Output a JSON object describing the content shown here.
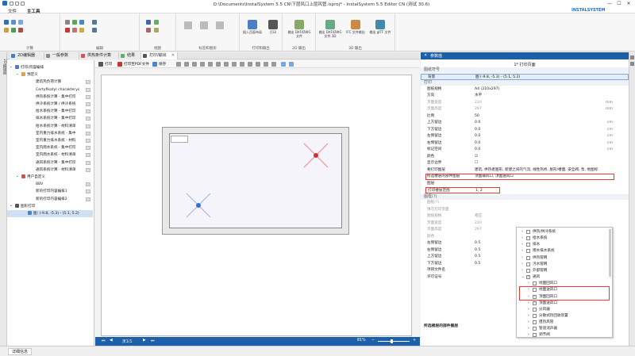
{
  "window": {
    "title": "D:\\Documents\\InstalSystem 5.5 CN\\下层风口上层风管.isproj* - InstalSystem 5.5 Editor CN (测试 30.6)",
    "controls": [
      "—",
      "☐",
      "✕"
    ]
  },
  "menu": {
    "items": [
      "文件",
      "主工具"
    ],
    "brand": "INSTALSYSTEM",
    "search": "更改屏幕的窗口布置"
  },
  "ribbon": {
    "groups": [
      "计算",
      "编辑",
      "视图",
      "标签和图形",
      "打印和输出",
      "2D 输出",
      "3D 输出"
    ],
    "buttons": [
      "插入页面布局",
      "打印",
      "输出 DXF/DWG 文件",
      "输出 DXF/DWG 文件 3D",
      "IFC 文件输出",
      "输出 gITF 文件"
    ]
  },
  "left_rail": "2D编辑器",
  "tabs": [
    "2D编辑器",
    "一般参数",
    "供热条件计算",
    "结果",
    "打印/输出"
  ],
  "tree": {
    "root": "打印/内容编排",
    "predefined": "预定义",
    "items": [
      "建筑热负荷计算",
      "CertyfikatyI charakterys",
      "供热系统计算 - 集中打印",
      "供冷系统计算 / 供冷系统",
      "给水系统计算 - 集中打印",
      "排水系统计算 - 集中打印",
      "给水系统计算 - 材料清单",
      "室内重力排水系统 - 集中",
      "室内重力排水系统 - 材料",
      "室内雨水系统 - 集中打印",
      "室内雨水系统 - 材料清单",
      "通风系统计算 - 集中打印",
      "通风系统计算 - 材料清单"
    ],
    "user_defined": "用户自定义",
    "user_items": [
      "BBV",
      "新的打印内容编排1",
      "新的打印内容编排2"
    ],
    "drawing_print": "图形打印",
    "drawing_item": "图: (-9.8, -5.3) - (5.1, 5.2)"
  },
  "doc_toolbar": {
    "print": "打印",
    "print_pdf": "打印至PDF文件",
    "save": "保存"
  },
  "doc_footer": {
    "page": "页1/1",
    "zoom": "81%"
  },
  "properties": {
    "header": "参数值",
    "title": "1* 打印页面",
    "categories": [
      "图纸符号",
      "打印",
      "图框(?)",
      "打印/输出页面"
    ],
    "rows": [
      {
        "k": "背景",
        "v": "图 (-9.8, -5.3) - (5.1, 5.2)"
      },
      {
        "k": "图纸规格",
        "v": "A4 (210x297)"
      },
      {
        "k": "方向",
        "v": "水平"
      },
      {
        "k": "页面宽度",
        "v": "210",
        "u": "mm"
      },
      {
        "k": "页面高度",
        "v": "297",
        "u": "mm"
      },
      {
        "k": "比例",
        "v": "50"
      },
      {
        "k": "上方留边",
        "v": "0.0",
        "u": "cm"
      },
      {
        "k": "下方留边",
        "v": "0.0",
        "u": "cm"
      },
      {
        "k": "左侧留边",
        "v": "0.0",
        "u": "cm"
      },
      {
        "k": "右侧留边",
        "v": "0.0",
        "u": "cm"
      },
      {
        "k": "标记空间",
        "v": "0.0",
        "u": "cm"
      },
      {
        "k": "颜色",
        "v": "☑"
      },
      {
        "k": "显示边界",
        "v": "☐"
      },
      {
        "k": "要打印图层",
        "v": "建筑, 供热者图形, 新建之间的气流, 线性热桥, 屋形/楼面, 安全阀, 泵, 地图标"
      },
      {
        "k": "所选楼层的部件图层",
        "v": "顶面输风口, 顶面送风口"
      },
      {
        "k": "图层",
        "v": ""
      },
      {
        "k": "打印楼层范围",
        "v": "1, 2"
      },
      {
        "k": "图框(?)",
        "v": ""
      },
      {
        "k": "填写打印页面",
        "v": ""
      },
      {
        "k": "图纸规格",
        "v": "相应"
      },
      {
        "k": "页面宽度",
        "v": "210"
      },
      {
        "k": "页面高度",
        "v": "297"
      },
      {
        "k": "颜色",
        "v": ""
      },
      {
        "k": "左侧留边",
        "v": "0.5"
      },
      {
        "k": "右侧留边",
        "v": "0.5"
      },
      {
        "k": "上方留边",
        "v": "0.5"
      },
      {
        "k": "下方留边",
        "v": "0.5"
      },
      {
        "k": "项目文件名",
        "v": ""
      },
      {
        "k": "许可证号",
        "v": ""
      }
    ],
    "footer_label": "所选楼层的部件图层"
  },
  "dropdown": {
    "items": [
      {
        "label": "供热/供冷系统",
        "checked": false,
        "level": 1
      },
      {
        "label": "给水系统",
        "checked": false,
        "level": 1
      },
      {
        "label": "排水",
        "checked": false,
        "level": 1
      },
      {
        "label": "雨水排水系统",
        "checked": false,
        "level": 1
      },
      {
        "label": "供热管网",
        "checked": false,
        "level": 1
      },
      {
        "label": "污水管网",
        "checked": false,
        "level": 1
      },
      {
        "label": "外部管网",
        "checked": false,
        "level": 1
      },
      {
        "label": "通风",
        "checked": true,
        "level": 1
      },
      {
        "label": "地面回风口",
        "checked": false,
        "level": 2
      },
      {
        "label": "地面送风口",
        "checked": false,
        "level": 2
      },
      {
        "label": "顶面回风口",
        "checked": true,
        "level": 2
      },
      {
        "label": "顶面送风口",
        "checked": true,
        "level": 2
      },
      {
        "label": "分风器",
        "checked": false,
        "level": 2
      },
      {
        "label": "分散式热回收装置",
        "checked": false,
        "level": 2
      },
      {
        "label": "阻热风管",
        "checked": false,
        "level": 2
      },
      {
        "label": "管道消声器",
        "checked": false,
        "level": 2
      },
      {
        "label": "调节阀",
        "checked": false,
        "level": 2
      }
    ]
  },
  "status": {
    "tab": "详细信息"
  },
  "colors": {
    "accent": "#1e5faa",
    "highlight": "#e53935",
    "marker_red": "#d32f2f",
    "marker_blue": "#3a6fd0"
  }
}
